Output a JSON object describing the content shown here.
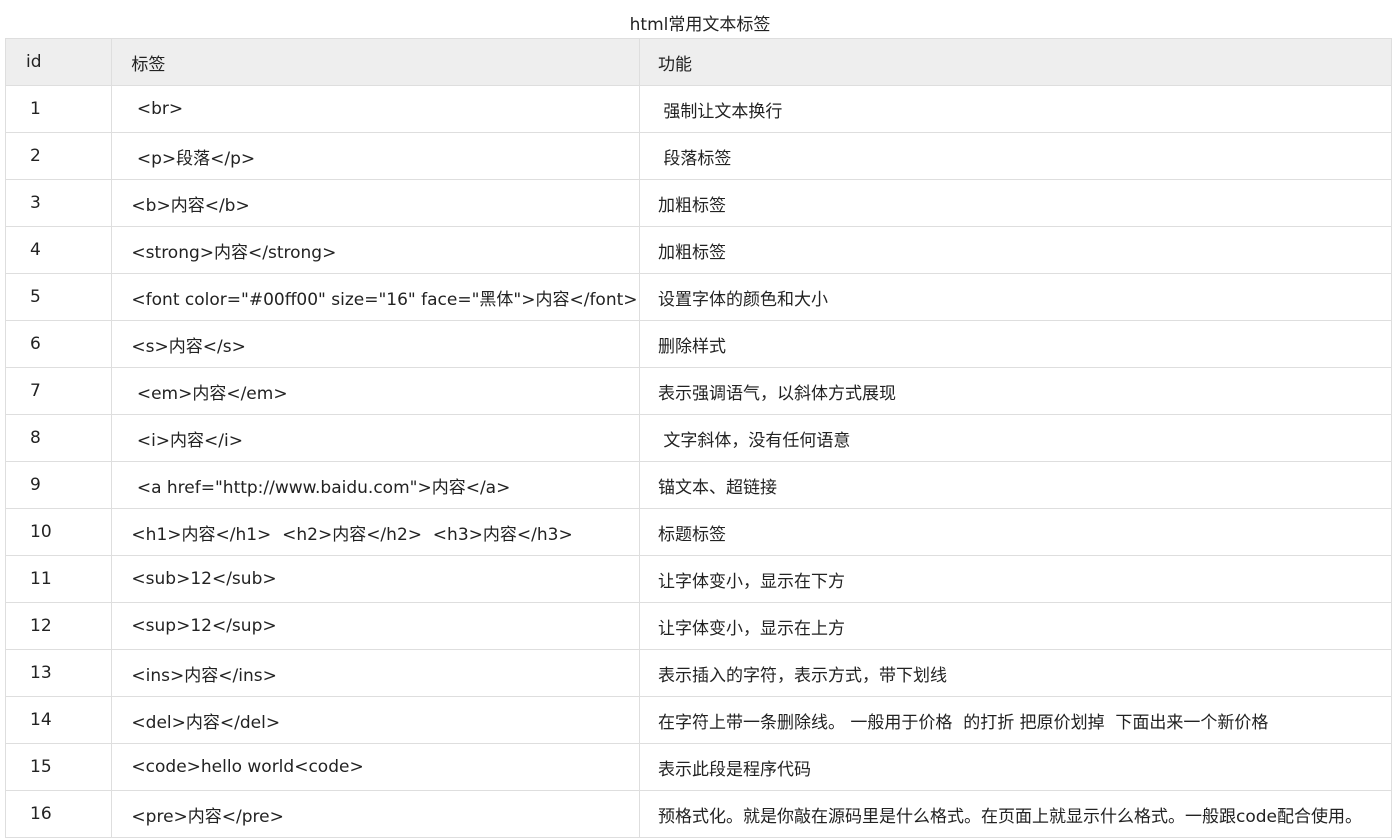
{
  "caption": "html常用文本标签",
  "headers": {
    "id": "id",
    "tag": "标签",
    "func": "功能"
  },
  "rows": [
    {
      "id": "1",
      "tag": " <br>",
      "func": " 强制让文本换行"
    },
    {
      "id": "2",
      "tag": " <p>段落</p>",
      "func": " 段落标签"
    },
    {
      "id": "3",
      "tag": "<b>内容</b>",
      "func": "加粗标签"
    },
    {
      "id": "4",
      "tag": "<strong>内容</strong>",
      "func": "加粗标签"
    },
    {
      "id": "5",
      "tag": "<font color=\"#00ff00\" size=\"16\" face=\"黑体\">内容</font>",
      "func": "设置字体的颜色和大小"
    },
    {
      "id": "6",
      "tag": "<s>内容</s>",
      "func": "删除样式"
    },
    {
      "id": "7",
      "tag": " <em>内容</em>",
      "func": "表示强调语气，以斜体方式展现"
    },
    {
      "id": "8",
      "tag": " <i>内容</i>",
      "func": " 文字斜体，没有任何语意"
    },
    {
      "id": "9",
      "tag": " <a href=\"http://www.baidu.com\">内容</a>",
      "func": "锚文本、超链接"
    },
    {
      "id": "10",
      "tag": "<h1>内容</h1>  <h2>内容</h2>  <h3>内容</h3>",
      "func": "标题标签"
    },
    {
      "id": "11",
      "tag": "<sub>12</sub>",
      "func": "让字体变小，显示在下方"
    },
    {
      "id": "12",
      "tag": "<sup>12</sup>",
      "func": "让字体变小，显示在上方"
    },
    {
      "id": "13",
      "tag": "<ins>内容</ins>",
      "func": "表示插入的字符，表示方式，带下划线"
    },
    {
      "id": "14",
      "tag": "<del>内容</del>",
      "func": "在字符上带一条删除线。 一般用于价格  的打折 把原价划掉  下面出来一个新价格"
    },
    {
      "id": "15",
      "tag": "<code>hello world<code>",
      "func": "表示此段是程序代码"
    },
    {
      "id": "16",
      "tag": "<pre>内容</pre>",
      "func": "预格式化。就是你敲在源码里是什么格式。在页面上就显示什么格式。一般跟code配合使用。"
    }
  ]
}
